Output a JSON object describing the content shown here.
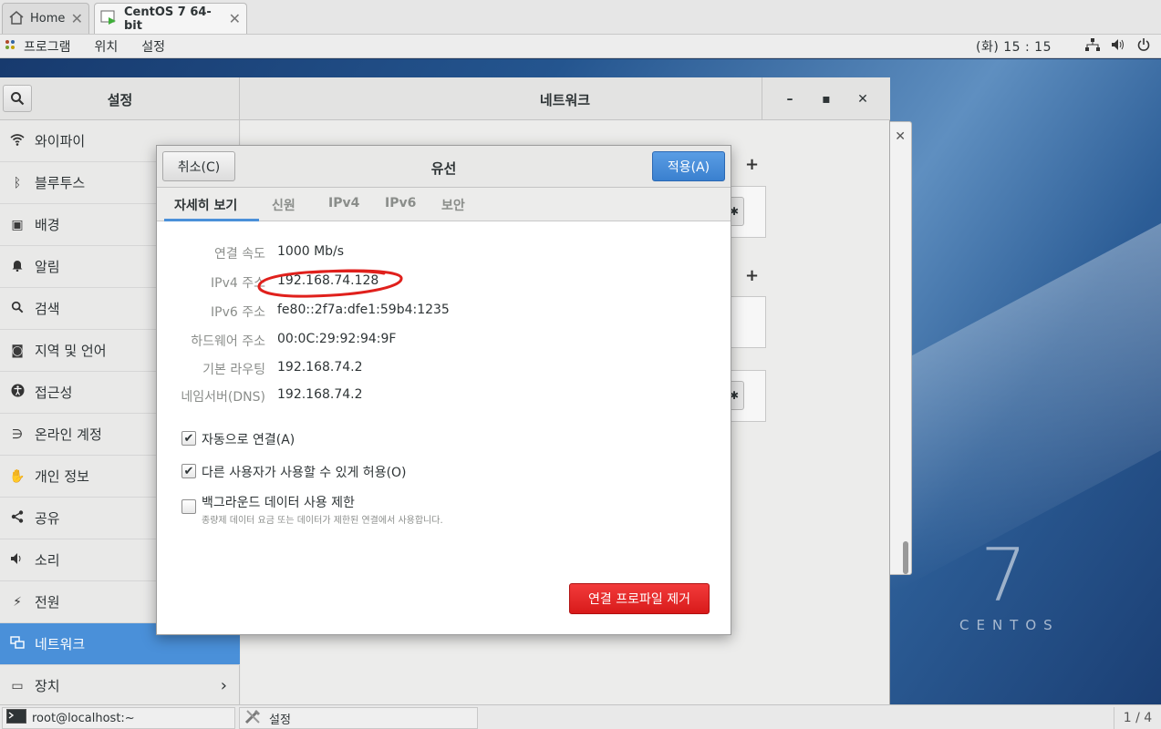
{
  "host_tabs": [
    {
      "label": "Home",
      "icon": "home-icon"
    },
    {
      "label": "CentOS 7 64-bit",
      "icon": "vm-icon"
    }
  ],
  "topbar": {
    "menu": [
      "프로그램",
      "위치",
      "설정"
    ],
    "clock": "(화) 15 : 15",
    "status_icons": [
      "network-icon",
      "volume-icon",
      "power-icon"
    ]
  },
  "desktop": {
    "logo_number": "7",
    "logo_word": "CENTOS"
  },
  "settings": {
    "sidebar_title": "설정",
    "main_title": "네트워크",
    "window_buttons": [
      "–",
      "▢",
      "✕"
    ],
    "sidebar_items": [
      {
        "label": "와이파이",
        "icon": "wifi-icon"
      },
      {
        "label": "블루투스",
        "icon": "bluetooth-icon"
      },
      {
        "label": "배경",
        "icon": "background-icon"
      },
      {
        "label": "알림",
        "icon": "bell-icon"
      },
      {
        "label": "검색",
        "icon": "search-icon"
      },
      {
        "label": "지역 및 언어",
        "icon": "region-icon"
      },
      {
        "label": "접근성",
        "icon": "accessibility-icon"
      },
      {
        "label": "온라인 계정",
        "icon": "online-accounts-icon"
      },
      {
        "label": "개인 정보",
        "icon": "privacy-icon"
      },
      {
        "label": "공유",
        "icon": "share-icon"
      },
      {
        "label": "소리",
        "icon": "sound-icon"
      },
      {
        "label": "전원",
        "icon": "power-icon"
      },
      {
        "label": "네트워크",
        "icon": "network-icon",
        "selected": true
      },
      {
        "label": "장치",
        "icon": "devices-icon"
      }
    ]
  },
  "dialog": {
    "title": "유선",
    "cancel_label": "취소(C)",
    "apply_label": "적용(A)",
    "tabs": [
      "자세히 보기",
      "신원",
      "IPv4",
      "IPv6",
      "보안"
    ],
    "details": [
      {
        "label": "연결 속도",
        "value": "1000 Mb/s"
      },
      {
        "label": "IPv4 주소",
        "value": "192.168.74.128"
      },
      {
        "label": "IPv6 주소",
        "value": "fe80::2f7a:dfe1:59b4:1235"
      },
      {
        "label": "하드웨어 주소",
        "value": "00:0C:29:92:94:9F"
      },
      {
        "label": "기본 라우팅",
        "value": "192.168.74.2"
      },
      {
        "label": "네임서버(DNS)",
        "value": "192.168.74.2"
      }
    ],
    "checks": [
      {
        "label": "자동으로 연결(A)",
        "checked": true
      },
      {
        "label": "다른 사용자가 사용할 수 있게 허용(O)",
        "checked": true
      },
      {
        "label": "백그라운드 데이터 사용 제한",
        "sub": "종량제 데이터 요금 또는 데이터가 제한된 연결에서 사용합니다.",
        "checked": false
      }
    ],
    "remove_label": "연결 프로파일 제거",
    "annotation_color": "#e0201c"
  },
  "taskbar": {
    "items": [
      {
        "label": "root@localhost:~",
        "icon": "terminal-icon"
      },
      {
        "label": "설정",
        "icon": "settings-tools-icon"
      }
    ],
    "workspace": "1 / 4"
  }
}
